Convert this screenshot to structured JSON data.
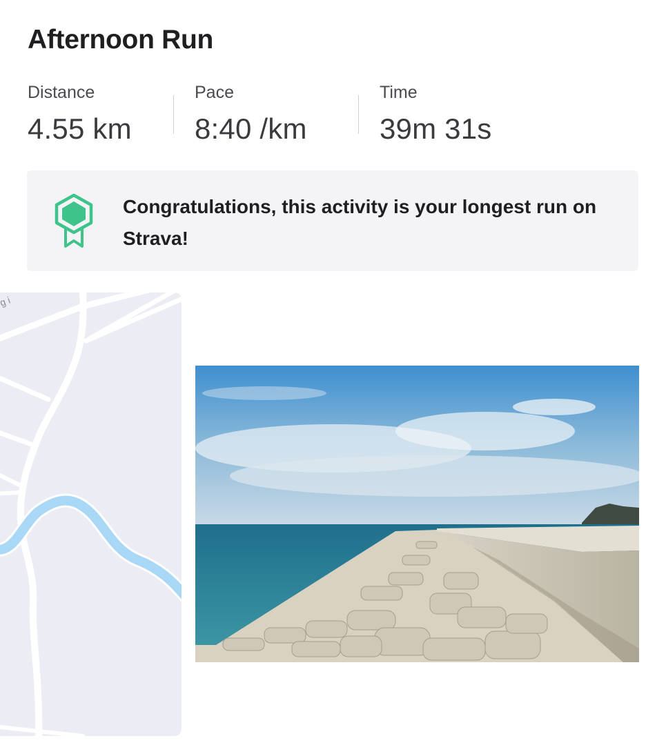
{
  "activity": {
    "title": "Afternoon Run"
  },
  "stats": {
    "distance": {
      "label": "Distance",
      "value": "4.55 km"
    },
    "pace": {
      "label": "Pace",
      "value": "8:40 /km"
    },
    "time": {
      "label": "Time",
      "value": "39m 31s"
    }
  },
  "achievement": {
    "message": "Congratulations, this activity is your longest run on Strava!",
    "icon": "medal-badge-icon",
    "icon_color": "#3ec48a"
  },
  "map": {
    "road_label_fragment": "g i"
  },
  "colors": {
    "banner_bg": "#f4f4f6",
    "map_bg": "#ececf4",
    "river": "#a9d7f6"
  }
}
